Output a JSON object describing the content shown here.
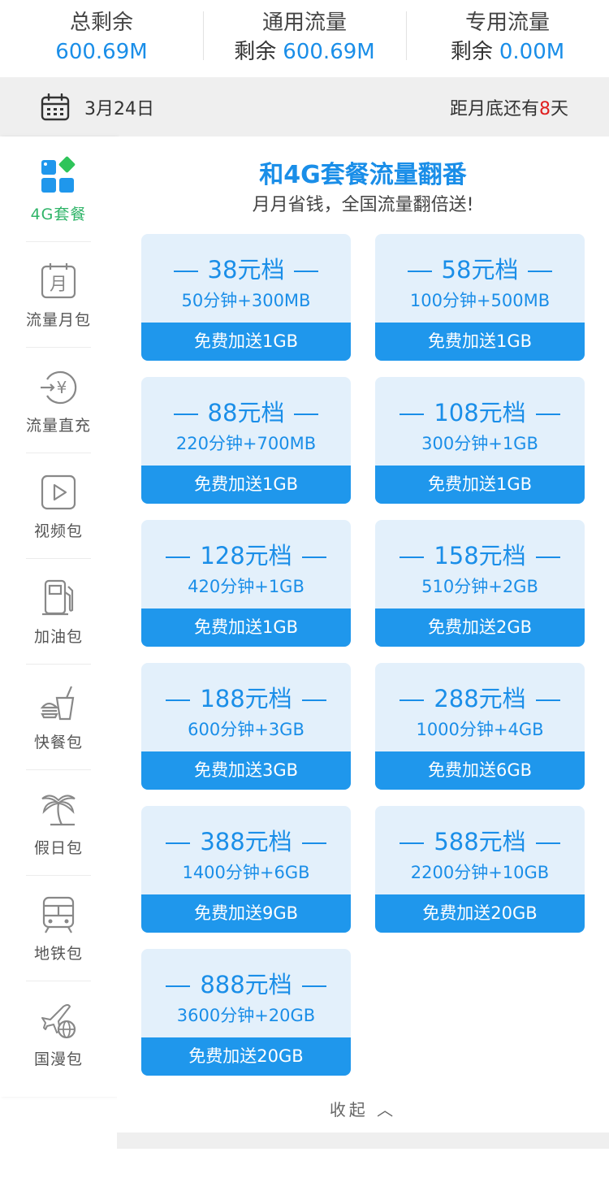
{
  "stats": [
    {
      "label": "总剩余",
      "prefix": "",
      "value": "600.69M"
    },
    {
      "label": "通用流量",
      "prefix": "剩余",
      "value": "600.69M"
    },
    {
      "label": "专用流量",
      "prefix": "剩余",
      "value": "0.00M"
    }
  ],
  "datebar": {
    "date": "3月24日",
    "remain_prefix": "距月底还有",
    "remain_days": "8",
    "remain_suffix": "天"
  },
  "sidebar": {
    "items": [
      {
        "label": "4G套餐",
        "icon": "blocks-icon",
        "active": true
      },
      {
        "label": "流量月包",
        "icon": "calendar-month-icon"
      },
      {
        "label": "流量直充",
        "icon": "yuan-recharge-icon"
      },
      {
        "label": "视频包",
        "icon": "play-icon"
      },
      {
        "label": "加油包",
        "icon": "fuel-pump-icon"
      },
      {
        "label": "快餐包",
        "icon": "fastfood-icon"
      },
      {
        "label": "假日包",
        "icon": "palm-tree-icon"
      },
      {
        "label": "地铁包",
        "icon": "subway-icon"
      },
      {
        "label": "国漫包",
        "icon": "plane-globe-icon"
      }
    ]
  },
  "content": {
    "title": "和4G套餐流量翻番",
    "subtitle": "月月省钱，全国流量翻倍送!",
    "collapse_label": "收起 ︿",
    "plans": [
      {
        "price": "38元档",
        "detail": "50分钟+300MB",
        "bonus": "免费加送1GB"
      },
      {
        "price": "58元档",
        "detail": "100分钟+500MB",
        "bonus": "免费加送1GB"
      },
      {
        "price": "88元档",
        "detail": "220分钟+700MB",
        "bonus": "免费加送1GB"
      },
      {
        "price": "108元档",
        "detail": "300分钟+1GB",
        "bonus": "免费加送1GB"
      },
      {
        "price": "128元档",
        "detail": "420分钟+1GB",
        "bonus": "免费加送1GB"
      },
      {
        "price": "158元档",
        "detail": "510分钟+2GB",
        "bonus": "免费加送2GB"
      },
      {
        "price": "188元档",
        "detail": "600分钟+3GB",
        "bonus": "免费加送3GB"
      },
      {
        "price": "288元档",
        "detail": "1000分钟+4GB",
        "bonus": "免费加送6GB"
      },
      {
        "price": "388元档",
        "detail": "1400分钟+6GB",
        "bonus": "免费加送9GB"
      },
      {
        "price": "588元档",
        "detail": "2200分钟+10GB",
        "bonus": "免费加送20GB"
      },
      {
        "price": "888元档",
        "detail": "3600分钟+20GB",
        "bonus": "免费加送20GB"
      }
    ]
  },
  "colors": {
    "accent": "#1a8ee8",
    "bonus_bar": "#1f97ec",
    "card_bg": "#e3f0fb",
    "active_green": "#2fb468",
    "days_red": "#e02020"
  }
}
